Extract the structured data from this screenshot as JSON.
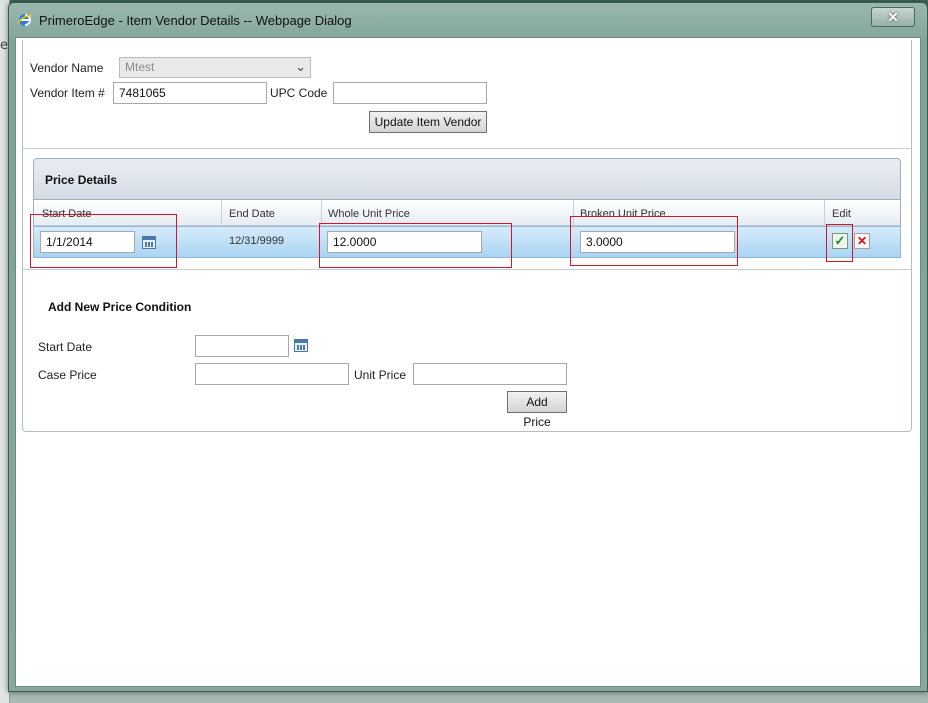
{
  "window": {
    "title": "PrimeroEdge - Item Vendor Details -- Webpage Dialog",
    "close_label": "✕",
    "background_letter": "e"
  },
  "vendor": {
    "name_label": "Vendor Name",
    "name_value": "Mtest",
    "item_label": "Vendor Item #",
    "item_value": "7481065",
    "upc_label": "UPC  Code",
    "upc_value": "",
    "update_button": "Update Item Vendor"
  },
  "price_details": {
    "title": "Price Details",
    "columns": [
      "Start Date",
      "End Date",
      "Whole Unit Price",
      "Broken Unit Price",
      "Edit"
    ],
    "row": {
      "start_date": "1/1/2014",
      "end_date": "12/31/9999",
      "whole_unit_price": "12.0000",
      "broken_unit_price": "3.0000"
    },
    "icons": [
      "calendar-icon",
      "checkmark-icon",
      "delete-x-icon"
    ]
  },
  "new_price": {
    "title": "Add New Price Condition",
    "start_date_label": "Start Date",
    "start_date_value": "",
    "case_price_label": "Case Price",
    "case_price_value": "",
    "unit_price_label": "Unit Price",
    "unit_price_value": "",
    "add_button": "Add Price"
  },
  "colors": {
    "highlight": "#d2152b",
    "row_blue": "#a9d4f3",
    "header_gray": "#d5dce5"
  }
}
